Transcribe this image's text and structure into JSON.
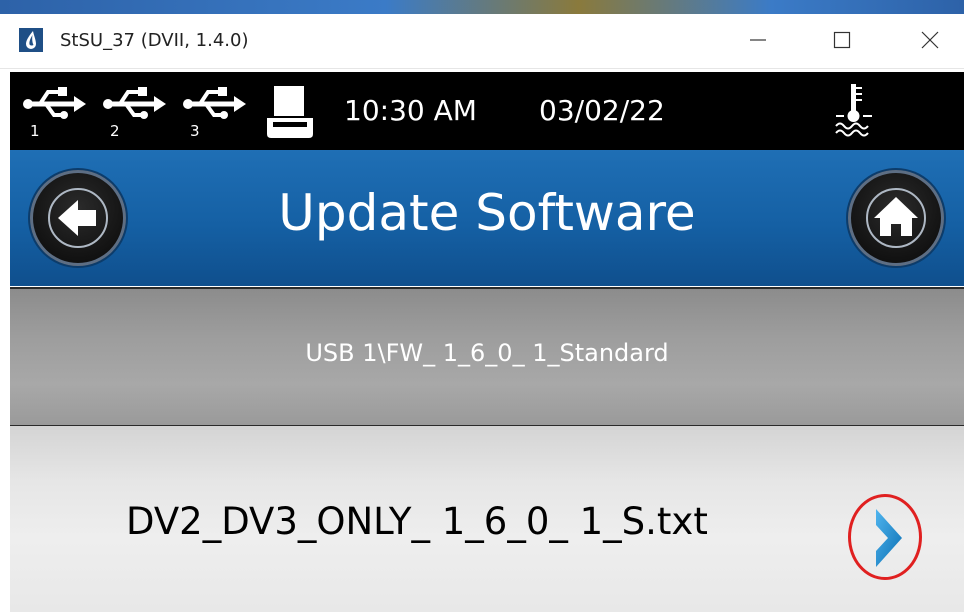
{
  "window": {
    "title": "StSU_37 (DVII, 1.4.0)",
    "controls": [
      "minimize",
      "maximize",
      "close"
    ]
  },
  "status_bar": {
    "usb_ports": [
      {
        "label": "1",
        "icon": "usb-icon"
      },
      {
        "label": "2",
        "icon": "usb-icon"
      },
      {
        "label": "3",
        "icon": "usb-icon"
      }
    ],
    "printer_icon": "printer-icon",
    "time": "10:30 AM",
    "date": "03/02/22",
    "temperature_icon": "temperature-probe-icon"
  },
  "header": {
    "title": "Update Software",
    "back_icon": "back-arrow-icon",
    "home_icon": "home-icon",
    "color": "#1560a4"
  },
  "path": {
    "text": "USB  1\\FW_ 1_6_0_ 1_Standard"
  },
  "files": [
    {
      "name": "DV2_DV3_ONLY_ 1_6_0_ 1_S.txt",
      "action_icon": "chevron-right-icon",
      "highlighted": true
    }
  ],
  "colors": {
    "chevron": "#1e8fd6",
    "highlight_ring": "#e02020"
  }
}
